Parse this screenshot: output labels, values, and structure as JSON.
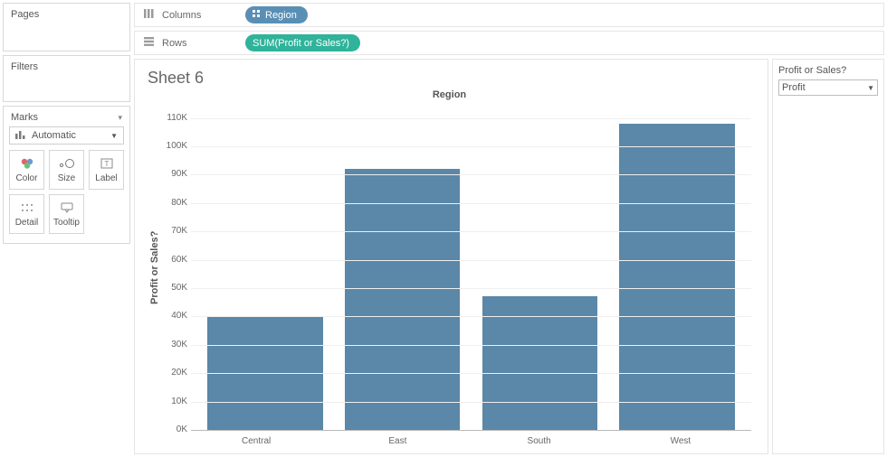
{
  "sidebar": {
    "pages_label": "Pages",
    "filters_label": "Filters",
    "marks": {
      "label": "Marks",
      "type": "Automatic",
      "buttons": {
        "color": "Color",
        "size": "Size",
        "label": "Label",
        "detail": "Detail",
        "tooltip": "Tooltip"
      }
    }
  },
  "shelves": {
    "columns_label": "Columns",
    "rows_label": "Rows",
    "columns_pill": "Region",
    "rows_pill": "SUM(Profit or Sales?)"
  },
  "sheet": {
    "title": "Sheet 6",
    "axis_title_top": "Region",
    "y_axis_label": "Profit or Sales?"
  },
  "parameter": {
    "title": "Profit or Sales?",
    "value": "Profit"
  },
  "colors": {
    "pill_blue": "#5a8fb5",
    "pill_green": "#2fb39a",
    "bar": "#5b87a8"
  },
  "chart_data": {
    "type": "bar",
    "title": "Region",
    "xlabel": "",
    "ylabel": "Profit or Sales?",
    "ylim": [
      0,
      115000
    ],
    "y_ticks": [
      "0K",
      "10K",
      "20K",
      "30K",
      "40K",
      "50K",
      "60K",
      "70K",
      "80K",
      "90K",
      "100K",
      "110K"
    ],
    "categories": [
      "Central",
      "East",
      "South",
      "West"
    ],
    "values": [
      40000,
      92000,
      47000,
      108000
    ]
  }
}
